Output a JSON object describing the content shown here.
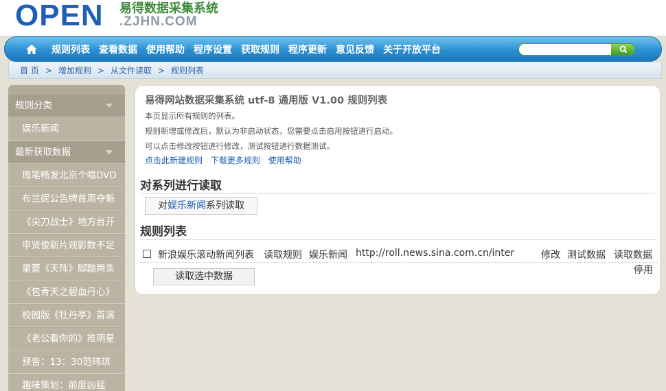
{
  "logo": {
    "brand": "OPEN",
    "title_cn": "易得数据采集系统",
    "domain": ".ZJHN.COM"
  },
  "nav": {
    "items": [
      "规则列表",
      "查看数据",
      "使用帮助",
      "程序设置",
      "获取规则",
      "程序更新",
      "意见反馈",
      "关于开放平台"
    ],
    "search_value": ""
  },
  "breadcrumb": [
    "首 页",
    "增加规则",
    "从文件读取",
    "规则列表"
  ],
  "sidebar": {
    "items": [
      {
        "label": "规则分类",
        "kind": "category"
      },
      {
        "label": "娱乐新闻",
        "kind": "sub"
      },
      {
        "label": "最新获取数据",
        "kind": "category"
      },
      {
        "label": "周笔畅发北京个唱DVD",
        "kind": "sub"
      },
      {
        "label": "布兰妮公告牌首周夺魁",
        "kind": "sub"
      },
      {
        "label": "《尖刀战士》地方台开",
        "kind": "sub"
      },
      {
        "label": "申贤俊新片观影数不足",
        "kind": "sub"
      },
      {
        "label": "童蕾《天阵》脚踏两条",
        "kind": "sub"
      },
      {
        "label": "《包青天之碧血丹心》",
        "kind": "sub"
      },
      {
        "label": "校园版《牡丹亭》首演",
        "kind": "sub"
      },
      {
        "label": "《老公看你的》推明星",
        "kind": "sub"
      },
      {
        "label": "预告：13：30范玮琪",
        "kind": "sub"
      },
      {
        "label": "趣味策划：前度凶猛",
        "kind": "sub"
      }
    ]
  },
  "main": {
    "title": "易得网站数据采集系统 utf-8 通用版 V1.00 规则列表",
    "desc": [
      "本页显示所有规则的列表。",
      "规则新增或修改后，默认为非启动状态，您需要点击启用按钮进行启动。",
      "可以点击修改按钮进行修改，测试按钮进行数据测试。"
    ],
    "links": [
      "点击此新建规则",
      "下载更多规则",
      "使用帮助"
    ],
    "series_heading": "对系列进行读取",
    "series_button": {
      "prefix": "对",
      "highlight": "娱乐新闻",
      "suffix": "系列读取"
    },
    "rules_heading": "规则列表",
    "rule": {
      "name": "新浪娱乐滚动新闻列表",
      "read": "读取规则",
      "category": "娱乐新闻",
      "url": "http://roll.news.sina.com.cn/inter",
      "edit": "修改",
      "test": "测试数据",
      "read_data": "读取数据",
      "stop": "停用"
    },
    "read_selected_button": "读取选中数据"
  }
}
